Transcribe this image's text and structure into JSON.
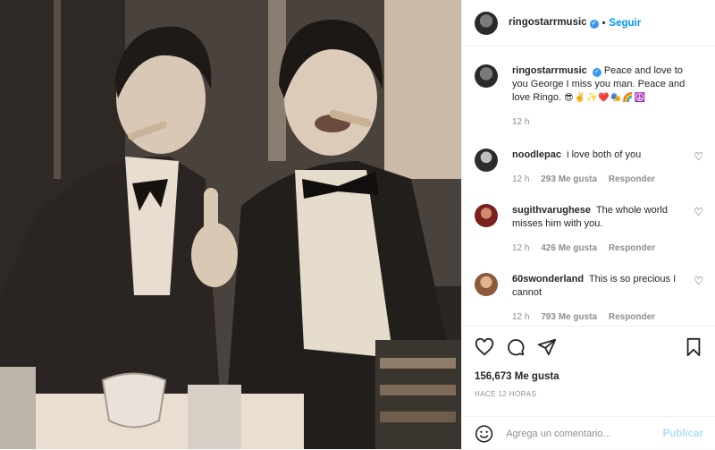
{
  "post": {
    "author": "ringostarrmusic",
    "follow_label": "Seguir",
    "caption": {
      "author": "ringostarrmusic",
      "text": "Peace and love to you George I miss you man. Peace and love Ringo.",
      "emojis": "😎✌️✨❤️🎭🌈☮️",
      "time": "12 h"
    },
    "comments": [
      {
        "user": "noodlepac",
        "text": "i love both of you",
        "time": "12 h",
        "likes": "293 Me gusta",
        "reply": "Responder"
      },
      {
        "user": "sugithvarughese",
        "text": "The whole world misses him with you.",
        "time": "12 h",
        "likes": "426 Me gusta",
        "reply": "Responder"
      },
      {
        "user": "60swonderland",
        "text": "This is so precious I cannot",
        "time": "12 h",
        "likes": "793 Me gusta",
        "reply": "Responder"
      }
    ],
    "likes_count": "156,673 Me gusta",
    "posted_ago": "HACE 12 HORAS",
    "comment_placeholder": "Agrega un comentario...",
    "publish_label": "Publicar"
  },
  "icons": {
    "like": "heart-icon",
    "comment": "comment-icon",
    "share": "paper-plane-icon",
    "save": "bookmark-icon",
    "emoji": "smiley-icon",
    "verified": "verified-badge-icon"
  },
  "colors": {
    "link": "#0095f6",
    "verified": "#3897f0",
    "muted": "#8e8e8e",
    "publish_disabled": "#b2dffc"
  }
}
